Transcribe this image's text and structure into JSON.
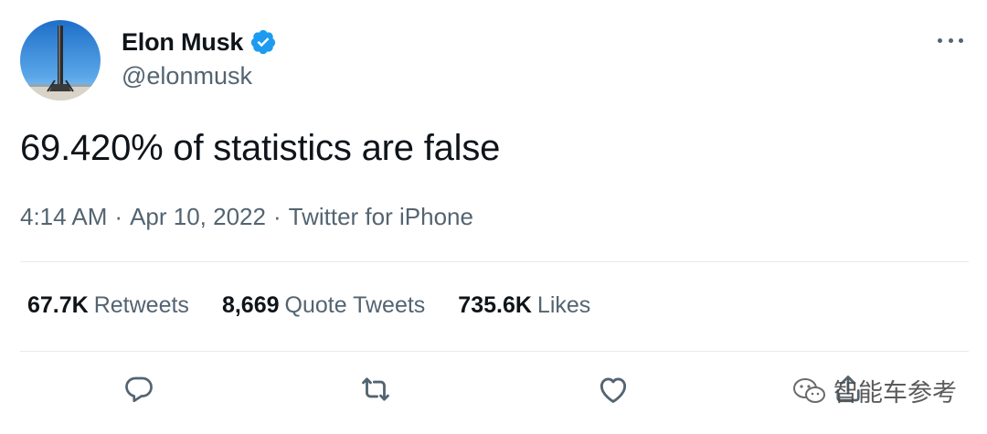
{
  "author": {
    "display_name": "Elon Musk",
    "handle": "@elonmusk",
    "verified": true
  },
  "tweet": {
    "text": "69.420% of statistics are false",
    "time": "4:14 AM",
    "date": "Apr 10, 2022",
    "source": "Twitter for iPhone",
    "separator": "·"
  },
  "stats": {
    "retweets": {
      "count": "67.7K",
      "label": "Retweets"
    },
    "quotes": {
      "count": "8,669",
      "label": "Quote Tweets"
    },
    "likes": {
      "count": "735.6K",
      "label": "Likes"
    }
  },
  "actions": [
    "reply-icon",
    "retweet-icon",
    "like-icon",
    "share-icon"
  ],
  "watermark": {
    "text": "智能车参考"
  },
  "colors": {
    "text_primary": "#0f1419",
    "text_secondary": "#536471",
    "verified_blue": "#1d9bf0",
    "divider": "#e7e9ea"
  }
}
